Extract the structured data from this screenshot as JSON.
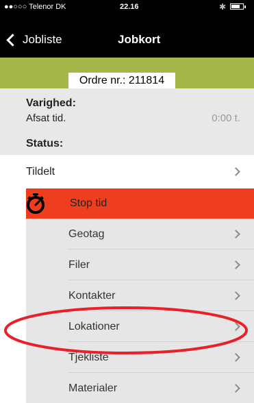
{
  "status_bar": {
    "carrier": "●●○○○ Telenor DK",
    "time": "22.16"
  },
  "nav": {
    "back_label": "Jobliste",
    "title": "Jobkort"
  },
  "order": {
    "label": "Ordre nr.: 211814"
  },
  "duration": {
    "header": "Varighed:",
    "label": "Afsat tid.",
    "value": "0:00 t."
  },
  "status": {
    "header": "Status:",
    "value": "Tildelt"
  },
  "timer": {
    "label": "Stop tid"
  },
  "menu": [
    {
      "label": "Geotag"
    },
    {
      "label": "Filer"
    },
    {
      "label": "Kontakter"
    },
    {
      "label": "Lokationer"
    },
    {
      "label": "Tjekliste"
    },
    {
      "label": "Materialer"
    }
  ],
  "colors": {
    "accent_green": "#a4b84a",
    "stop_red": "#ee3e1e",
    "highlight_ring": "#e8202a"
  }
}
